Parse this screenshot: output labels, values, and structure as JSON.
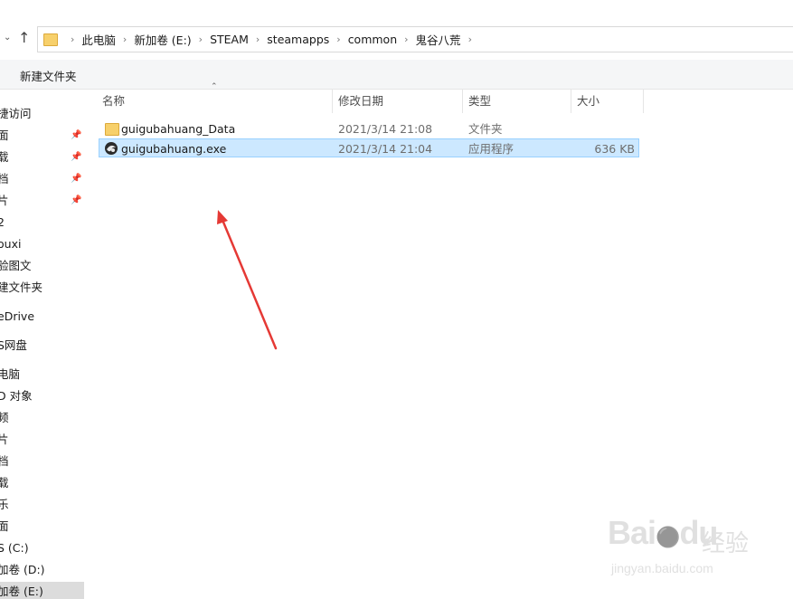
{
  "address": {
    "breadcrumbs": [
      "此电脑",
      "新加卷 (E:)",
      "STEAM",
      "steamapps",
      "common",
      "鬼谷八荒"
    ],
    "up_icon": "up-arrow-icon",
    "recent_icon": "chevron-down-icon"
  },
  "toolbar": {
    "new_folder_label": "新建文件夹"
  },
  "nav": {
    "items": [
      {
        "label": "捷访问"
      },
      {
        "label": "面",
        "pinned": true
      },
      {
        "label": "载",
        "pinned": true
      },
      {
        "label": "档",
        "pinned": true
      },
      {
        "label": "片",
        "pinned": true
      },
      {
        "label": "2"
      },
      {
        "label": "ouxi"
      },
      {
        "label": "验图文"
      },
      {
        "label": "建文件夹"
      },
      {
        "label": "eDrive"
      },
      {
        "label": "S网盘"
      },
      {
        "label": "电脑"
      },
      {
        "label": "D 对象"
      },
      {
        "label": "频"
      },
      {
        "label": "片"
      },
      {
        "label": "档"
      },
      {
        "label": "载"
      },
      {
        "label": "乐"
      },
      {
        "label": "面"
      },
      {
        "label": "S (C:)"
      },
      {
        "label": "加卷 (D:)"
      },
      {
        "label": "加卷 (E:)",
        "selected": true
      }
    ]
  },
  "columns": {
    "name": "名称",
    "modified": "修改日期",
    "type": "类型",
    "size": "大小"
  },
  "files": [
    {
      "name": "guigubahuang_Data",
      "modified": "2021/3/14 21:08",
      "type": "文件夹",
      "size": "",
      "icon": "folder-icon"
    },
    {
      "name": "guigubahuang.exe",
      "modified": "2021/3/14 21:04",
      "type": "应用程序",
      "size": "636 KB",
      "icon": "exe-icon",
      "selected": true
    }
  ],
  "annotation": {
    "color": "#e53935"
  },
  "watermark": {
    "brand": "Bai",
    "brand2": "du",
    "cn": "经验",
    "url": "jingyan.baidu.com"
  },
  "colors": {
    "selection": "#cce8ff",
    "selection_border": "#99d1ff",
    "folder": "#f7d06b"
  }
}
